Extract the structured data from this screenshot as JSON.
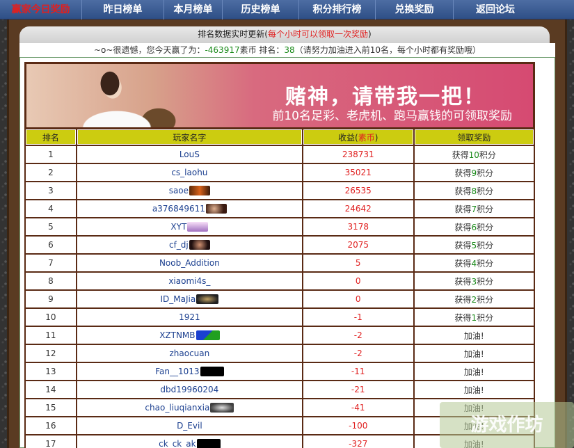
{
  "nav": {
    "items": [
      {
        "label": "赢家今日奖励",
        "current": true
      },
      {
        "label": "昨日榜单"
      },
      {
        "label": "本月榜单"
      },
      {
        "label": "历史榜单"
      },
      {
        "label": "积分排行榜"
      },
      {
        "label": "兑换奖励"
      },
      {
        "label": "返回论坛"
      }
    ]
  },
  "notice": {
    "prefix": "排名数据实时更新(",
    "highlight": "每个小时可以领取一次奖励",
    "suffix": ")"
  },
  "status": {
    "prefix": "~o~很遗憾，您今天赢了为：",
    "amount": "-463917",
    "currency_label": "素币 排名：",
    "rank": "38",
    "hint": "（请努力加油进入前10名，每个小时都有奖励哦）"
  },
  "banner": {
    "headline": "赌神，请带我一把！",
    "subline": "前10名足彩、老虎机、跑马赢钱的可领取奖励"
  },
  "table": {
    "headers": {
      "rank": "排名",
      "player": "玩家名字",
      "income_prefix": "收益(",
      "income_unit": "素币",
      "income_suffix": ")",
      "reward": "领取奖励"
    },
    "rows": [
      {
        "rank": "1",
        "name": "LouS",
        "score": "238731",
        "reward_prefix": "获得",
        "reward_num": "10",
        "reward_suffix": "积分",
        "medal": ""
      },
      {
        "rank": "2",
        "name": "cs_laohu",
        "score": "35021",
        "reward_prefix": "获得",
        "reward_num": "9",
        "reward_suffix": "积分",
        "medal": ""
      },
      {
        "rank": "3",
        "name": "saoe",
        "score": "26535",
        "reward_prefix": "获得",
        "reward_num": "8",
        "reward_suffix": "积分",
        "medal": "m-fire"
      },
      {
        "rank": "4",
        "name": "a376849611",
        "score": "24642",
        "reward_prefix": "获得",
        "reward_num": "7",
        "reward_suffix": "积分",
        "medal": "m-face"
      },
      {
        "rank": "5",
        "name": "XYT",
        "score": "3178",
        "reward_prefix": "获得",
        "reward_num": "6",
        "reward_suffix": "积分",
        "medal": "m-text"
      },
      {
        "rank": "6",
        "name": "cf_dj",
        "score": "2075",
        "reward_prefix": "获得",
        "reward_num": "5",
        "reward_suffix": "积分",
        "medal": "m-dark"
      },
      {
        "rank": "7",
        "name": "Noob_Addition",
        "score": "5",
        "reward_prefix": "获得",
        "reward_num": "4",
        "reward_suffix": "积分",
        "medal": ""
      },
      {
        "rank": "8",
        "name": "xiaomi4s_",
        "score": "0",
        "reward_prefix": "获得",
        "reward_num": "3",
        "reward_suffix": "积分",
        "medal": ""
      },
      {
        "rank": "9",
        "name": "ID_MaJia",
        "score": "0",
        "reward_prefix": "获得",
        "reward_num": "2",
        "reward_suffix": "积分",
        "medal": "m-badge"
      },
      {
        "rank": "10",
        "name": "1921",
        "score": "-1",
        "reward_prefix": "获得",
        "reward_num": "1",
        "reward_suffix": "积分",
        "medal": ""
      },
      {
        "rank": "11",
        "name": "XZTNMB",
        "score": "-2",
        "reward_text": "加油!",
        "medal": "m-blue"
      },
      {
        "rank": "12",
        "name": "zhaocuan",
        "score": "-2",
        "reward_text": "加油!",
        "medal": ""
      },
      {
        "rank": "13",
        "name": "Fan__1013",
        "score": "-11",
        "reward_text": "加油!",
        "medal": "m-black"
      },
      {
        "rank": "14",
        "name": "dbd19960204",
        "score": "-21",
        "reward_text": "加油!",
        "medal": ""
      },
      {
        "rank": "15",
        "name": "chao_liuqianxia",
        "score": "-41",
        "reward_text": "加油!",
        "medal": "m-gray"
      },
      {
        "rank": "16",
        "name": "D_Evil",
        "score": "-100",
        "reward_text": "加油!",
        "medal": ""
      },
      {
        "rank": "17",
        "name": "ck_ck_ak",
        "score": "-327",
        "reward_text": "加油!",
        "medal": "m-black"
      }
    ]
  },
  "watermark": {
    "text": "游戏作坊"
  }
}
